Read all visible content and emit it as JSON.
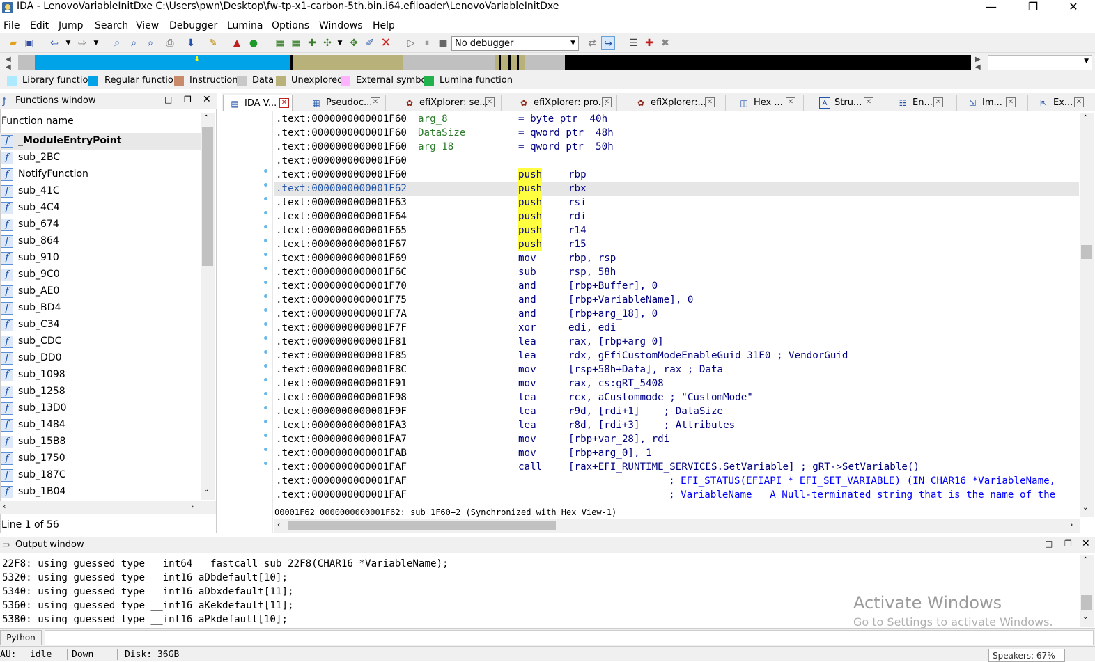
{
  "title": "IDA - LenovoVariableInitDxe C:\\Users\\pwn\\Desktop\\fw-tp-x1-carbon-5th.bin.i64.efiloader\\LenovoVariableInitDxe",
  "window_controls": {
    "minimize": "—",
    "maximize": "❐",
    "close": "✕"
  },
  "menu": [
    "File",
    "Edit",
    "Jump",
    "Search",
    "View",
    "Debugger",
    "Lumina",
    "Options",
    "Windows",
    "Help"
  ],
  "debugger_select": "No debugger",
  "legend": [
    {
      "label": "Library function",
      "color": "#aeeaff"
    },
    {
      "label": "Regular function",
      "color": "#00a3e8"
    },
    {
      "label": "Instruction",
      "color": "#c98a6a"
    },
    {
      "label": "Data",
      "color": "#c8c8c8"
    },
    {
      "label": "Unexplored",
      "color": "#b8b27a"
    },
    {
      "label": "External symbol",
      "color": "#ffb3ff"
    },
    {
      "label": "Lumina function",
      "color": "#22b24c"
    }
  ],
  "functions_window": {
    "title": "Functions window",
    "column": "Function name",
    "items": [
      "_ModuleEntryPoint",
      "sub_2BC",
      "NotifyFunction",
      "sub_41C",
      "sub_4C4",
      "sub_674",
      "sub_864",
      "sub_910",
      "sub_9C0",
      "sub_AE0",
      "sub_BD4",
      "sub_C34",
      "sub_CDC",
      "sub_DD0",
      "sub_1098",
      "sub_1258",
      "sub_13D0",
      "sub_1484",
      "sub_15B8",
      "sub_1750",
      "sub_187C",
      "sub_1B04"
    ],
    "status": "Line 1 of 56"
  },
  "tabs": [
    "IDA V...",
    "Pseudoc...",
    "efiXplorer: se...",
    "efiXplorer: pro...",
    "efiXplorer:...",
    "Hex ...",
    "Stru...",
    "En...",
    "Im...",
    "Ex..."
  ],
  "disasm": [
    {
      "addr": ".text:0000000000001F60",
      "label": "arg_8",
      "mnem": "",
      "ops": "= byte ptr  40h",
      "dot": false
    },
    {
      "addr": ".text:0000000000001F60",
      "label": "DataSize",
      "mnem": "",
      "ops": "= qword ptr  48h",
      "dot": false
    },
    {
      "addr": ".text:0000000000001F60",
      "label": "arg_18",
      "mnem": "",
      "ops": "= qword ptr  50h",
      "dot": false
    },
    {
      "addr": ".text:0000000000001F60",
      "label": "",
      "mnem": "",
      "ops": "",
      "dot": false
    },
    {
      "addr": ".text:0000000000001F60",
      "label": "",
      "mnem": "push",
      "ops": "rbp",
      "dot": true,
      "hl": true
    },
    {
      "addr": ".text:0000000000001F62",
      "label": "",
      "mnem": "push",
      "ops": "rbx",
      "dot": true,
      "hl": true,
      "cur": true
    },
    {
      "addr": ".text:0000000000001F63",
      "label": "",
      "mnem": "push",
      "ops": "rsi",
      "dot": true,
      "hl": true
    },
    {
      "addr": ".text:0000000000001F64",
      "label": "",
      "mnem": "push",
      "ops": "rdi",
      "dot": true,
      "hl": true
    },
    {
      "addr": ".text:0000000000001F65",
      "label": "",
      "mnem": "push",
      "ops": "r14",
      "dot": true,
      "hl": true
    },
    {
      "addr": ".text:0000000000001F67",
      "label": "",
      "mnem": "push",
      "ops": "r15",
      "dot": true,
      "hl": true
    },
    {
      "addr": ".text:0000000000001F69",
      "label": "",
      "mnem": "mov",
      "ops": "rbp, rsp",
      "dot": true
    },
    {
      "addr": ".text:0000000000001F6C",
      "label": "",
      "mnem": "sub",
      "ops": "rsp, 58h",
      "dot": true
    },
    {
      "addr": ".text:0000000000001F70",
      "label": "",
      "mnem": "and",
      "ops": "[rbp+Buffer], 0",
      "dot": true
    },
    {
      "addr": ".text:0000000000001F75",
      "label": "",
      "mnem": "and",
      "ops": "[rbp+VariableName], 0",
      "dot": true
    },
    {
      "addr": ".text:0000000000001F7A",
      "label": "",
      "mnem": "and",
      "ops": "[rbp+arg_18], 0",
      "dot": true
    },
    {
      "addr": ".text:0000000000001F7F",
      "label": "",
      "mnem": "xor",
      "ops": "edi, edi",
      "dot": true
    },
    {
      "addr": ".text:0000000000001F81",
      "label": "",
      "mnem": "lea",
      "ops": "rax, [rbp+arg_0]",
      "dot": true
    },
    {
      "addr": ".text:0000000000001F85",
      "label": "",
      "mnem": "lea",
      "ops": "rdx, gEfiCustomModeEnableGuid_31E0 ; VendorGuid",
      "dot": true
    },
    {
      "addr": ".text:0000000000001F8C",
      "label": "",
      "mnem": "mov",
      "ops": "[rsp+58h+Data], rax ; Data",
      "dot": true
    },
    {
      "addr": ".text:0000000000001F91",
      "label": "",
      "mnem": "mov",
      "ops": "rax, cs:gRT_5408",
      "dot": true
    },
    {
      "addr": ".text:0000000000001F98",
      "label": "",
      "mnem": "lea",
      "ops": "rcx, aCustommode ; \"CustomMode\"",
      "dot": true
    },
    {
      "addr": ".text:0000000000001F9F",
      "label": "",
      "mnem": "lea",
      "ops": "r9d, [rdi+1]    ; DataSize",
      "dot": true
    },
    {
      "addr": ".text:0000000000001FA3",
      "label": "",
      "mnem": "lea",
      "ops": "r8d, [rdi+3]    ; Attributes",
      "dot": true
    },
    {
      "addr": ".text:0000000000001FA7",
      "label": "",
      "mnem": "mov",
      "ops": "[rbp+var_28], rdi",
      "dot": true
    },
    {
      "addr": ".text:0000000000001FAB",
      "label": "",
      "mnem": "mov",
      "ops": "[rbp+arg_0], 1",
      "dot": true
    },
    {
      "addr": ".text:0000000000001FAF",
      "label": "",
      "mnem": "call",
      "ops": "[rax+EFI_RUNTIME_SERVICES.SetVariable] ; gRT->SetVariable()",
      "dot": true
    },
    {
      "addr": ".text:0000000000001FAF",
      "label": "",
      "mnem": "",
      "ops": "; EFI_STATUS(EFIAPI * EFI_SET_VARIABLE) (IN CHAR16 *VariableName,",
      "dot": false,
      "indent": true
    },
    {
      "addr": ".text:0000000000001FAF",
      "label": "",
      "mnem": "",
      "ops": "; VariableName   A Null-terminated string that is the name of the",
      "dot": false,
      "indent": true
    }
  ],
  "disasm_status": "00001F62 0000000000001F62: sub_1F60+2 (Synchronized with Hex View-1)",
  "output_window": {
    "title": "Output window",
    "lines": [
      "22F8: using guessed type __int64 __fastcall sub_22F8(CHAR16 *VariableName);",
      "5320: using guessed type __int16 aDbdefault[10];",
      "5340: using guessed type __int16 aDbxdefault[11];",
      "5360: using guessed type __int16 aKekdefault[11];",
      "5380: using guessed type __int16 aPkdefault[10];"
    ]
  },
  "watermark": {
    "line1": "Activate Windows",
    "line2": "Go to Settings to activate Windows."
  },
  "python_button": "Python",
  "statusbar": {
    "au": "AU:",
    "state": "idle",
    "dir": "Down",
    "disk": "Disk: 36GB",
    "speakers": "Speakers: 67%"
  }
}
